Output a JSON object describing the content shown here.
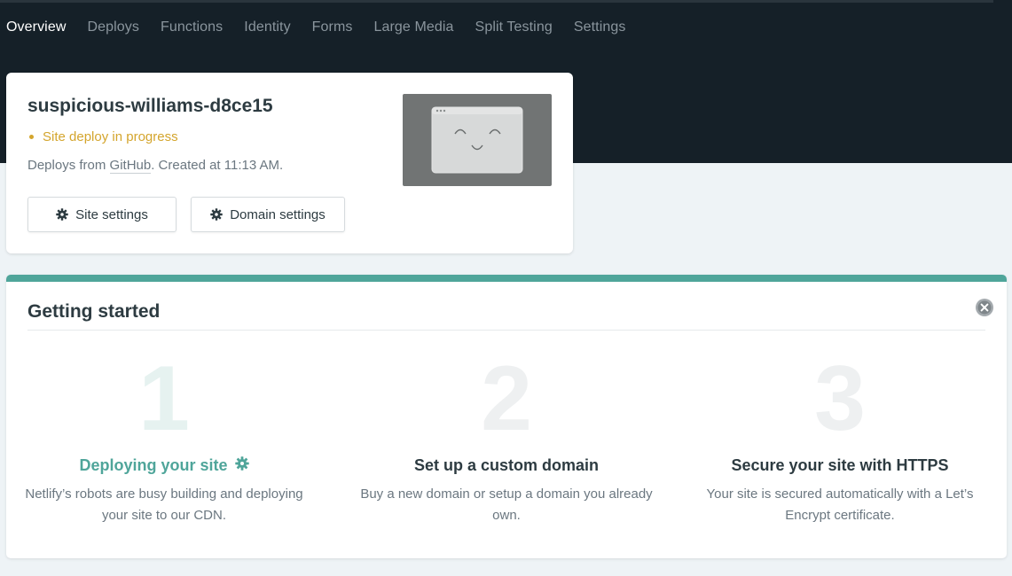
{
  "nav": {
    "tabs": [
      "Overview",
      "Deploys",
      "Functions",
      "Identity",
      "Forms",
      "Large Media",
      "Split Testing",
      "Settings"
    ],
    "active": "Overview"
  },
  "site": {
    "name": "suspicious-williams-d8ce15",
    "status": "Site deploy in progress",
    "deploy_prefix": "Deploys from ",
    "deploy_source": "GitHub",
    "deploy_suffix": ". Created at 11:13 AM.",
    "site_settings_label": "Site settings",
    "domain_settings_label": "Domain settings"
  },
  "getting_started": {
    "title": "Getting started",
    "steps": [
      {
        "number": "1",
        "title": "Deploying your site",
        "description": "Netlify’s robots are busy building and deploying your site to our CDN."
      },
      {
        "number": "2",
        "title": "Set up a custom domain",
        "description": "Buy a new domain or setup a domain you already own."
      },
      {
        "number": "3",
        "title": "Secure your site with HTTPS",
        "description": "Your site is secured automatically with a Let’s Encrypt certificate."
      }
    ]
  },
  "colors": {
    "header_bg": "#152028",
    "accent": "#4fa59a",
    "status": "#d4a52d",
    "page_bg": "#eef3f6"
  },
  "icons": [
    "gear-icon",
    "close-circle-icon",
    "browser-smile-icon",
    "spinner-gear-icon"
  ]
}
